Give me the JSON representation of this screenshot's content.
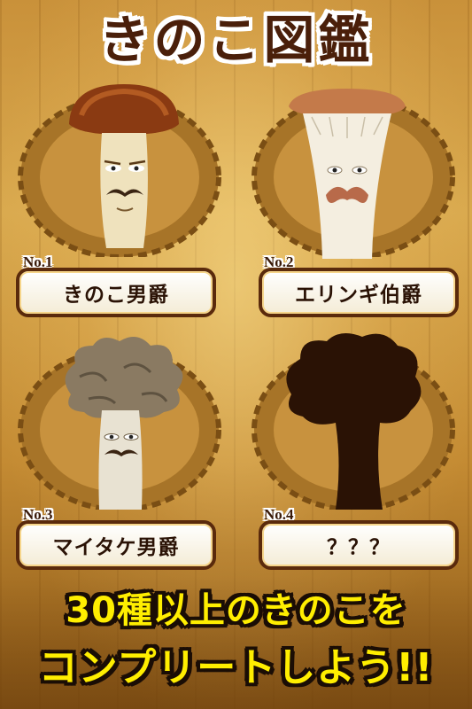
{
  "title": "きのこ図鑑",
  "cards": [
    {
      "number": "No.1",
      "name": "きのこ男爵"
    },
    {
      "number": "No.2",
      "name": "エリンギ伯爵"
    },
    {
      "number": "No.3",
      "name": "マイタケ男爵"
    },
    {
      "number": "No.4",
      "name": "？？？"
    }
  ],
  "banner": {
    "line1": "30種以上のきのこを",
    "line2": "コンプリートしよう!!"
  },
  "colors": {
    "title_text": "#4a1f0a",
    "banner_text": "#ffee00",
    "label_border": "#5a2a0c",
    "wreath": "#a77428",
    "silhouette": "#2a1205"
  }
}
